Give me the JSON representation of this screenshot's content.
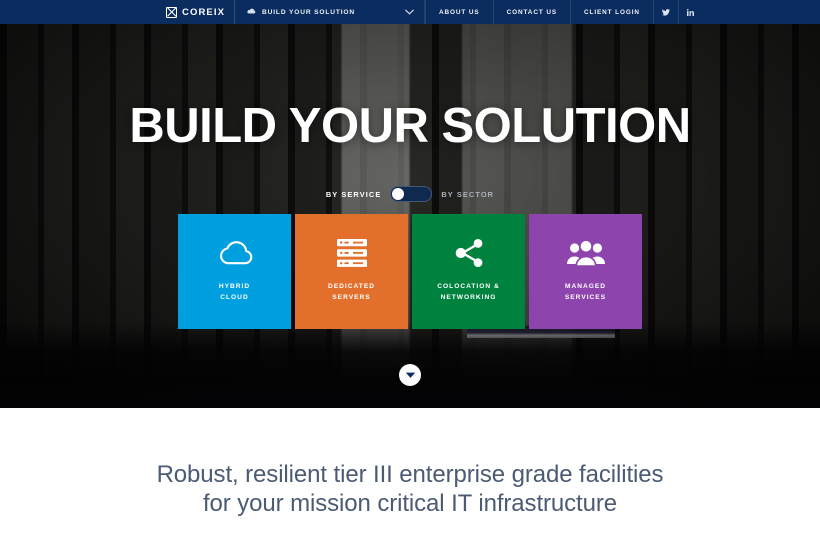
{
  "topbar": {
    "brand": {
      "name": "COREIX",
      "icon": "coreix-x-logo-icon"
    },
    "build_menu": {
      "label": "BUILD YOUR SOLUTION",
      "icon": "cloud-icon",
      "caret": "ˇ"
    },
    "links": [
      {
        "label": "ABOUT US",
        "name": "about-us"
      },
      {
        "label": "CONTACT US",
        "name": "contact-us"
      },
      {
        "label": "CLIENT LOGIN",
        "name": "client-login"
      }
    ],
    "social": [
      {
        "name": "twitter-icon",
        "title": "Twitter"
      },
      {
        "name": "linkedin-icon",
        "title": "LinkedIn"
      }
    ]
  },
  "hero": {
    "title": "BUILD YOUR SOLUTION",
    "toggle": {
      "left_label": "BY SERVICE",
      "right_label": "BY SECTOR",
      "selected": "BY SERVICE",
      "knob_position": "left"
    },
    "cards": [
      {
        "label": "HYBRID\nCLOUD",
        "color": "#00a0e0",
        "icon": "cloud-icon",
        "name": "card-hybrid-cloud"
      },
      {
        "label": "DEDICATED\nSERVERS",
        "color": "#e2702c",
        "icon": "server-stack-icon",
        "name": "card-dedicated-servers"
      },
      {
        "label": "COLOCATION &\nNETWORKING",
        "color": "#00823f",
        "icon": "share-network-icon",
        "name": "card-colocation-networking"
      },
      {
        "label": "MANAGED\nSERVICES",
        "color": "#8e44ad",
        "icon": "people-group-icon",
        "name": "card-managed-services"
      }
    ],
    "scroll_button": {
      "icon": "chevron-down-icon",
      "name": "scroll-down-button"
    }
  },
  "intro": {
    "headline": "Robust, resilient tier III enterprise grade facilities\nfor your mission critical IT infrastructure",
    "color": "#4b5b73"
  }
}
